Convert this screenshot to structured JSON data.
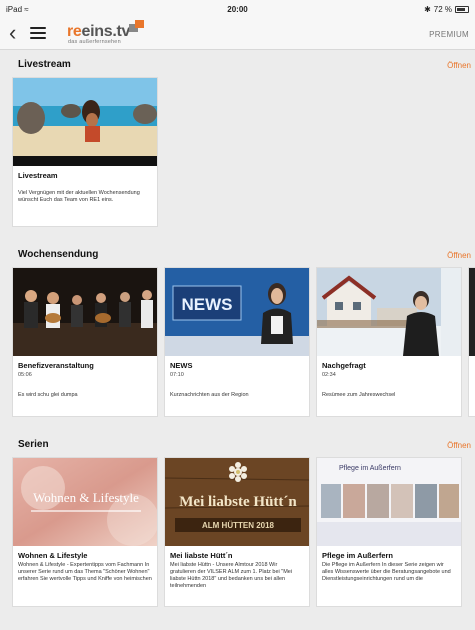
{
  "statusbar": {
    "device": "iPad",
    "time": "20:00",
    "battery": "72 %"
  },
  "navbar": {
    "logo_prefix": "re",
    "logo_main": "eins.tv",
    "logo_tagline": "das außerfernsehen",
    "premium_label": "PREMIUM"
  },
  "sections": {
    "livestream": {
      "title": "Livestream",
      "open_label": "Öffnen",
      "cards": [
        {
          "title": "Livestream",
          "description": "Viel Vergnügen mit der aktuellen Wochensendung wünscht Euch das Team von RE1 eins."
        }
      ]
    },
    "wochensendung": {
      "title": "Wochensendung",
      "open_label": "Öffnen",
      "cards": [
        {
          "title": "Benefizveranstaltung",
          "duration": "05:06",
          "description": "Es wird schu glei dumpa"
        },
        {
          "title": "NEWS",
          "duration": "07:10",
          "description": "Kurznachrichten aus der Region",
          "thumb_text": "NEWS"
        },
        {
          "title": "Nachgefragt",
          "duration": "02:34",
          "description": "Resümee zum Jahreswechsel"
        }
      ]
    },
    "serien": {
      "title": "Serien",
      "open_label": "Öffnen",
      "cards": [
        {
          "title": "Wohnen & Lifestyle",
          "thumb_text": "Wohnen & Lifestyle",
          "description": "Wohnen & Lifestyle - Expertentipps vom Fachmann In unserer Serie rund um das Thema \"Schöner Wohnen\" erfahren Sie wertvolle Tipps und Kniffe von heimischen"
        },
        {
          "title": "Mei liabste Hütt´n",
          "thumb_text": "Mei liabste Hütt´n",
          "thumb_subtext": "ALM  HÜTTEN 2018",
          "description": "Mei liabste Hüttn - Unsere Almtour 2018 Wir gratulieren der VILSER ALM zum 1. Platz bei \"Mei liabste Hüttn 2018\" und bedanken uns bei allen teilnehmenden"
        },
        {
          "title": "Pflege im Außerfern",
          "thumb_text": "Pflege im Außerfern",
          "description": "Die Pflege im Außerfern In dieser Serie zeigen wir alles Wissenswerte über die Beratungsangebote und Dienstleistungseinrichtungen rund um die"
        }
      ]
    }
  },
  "colors": {
    "accent": "#e9762b",
    "background": "#ececec"
  }
}
